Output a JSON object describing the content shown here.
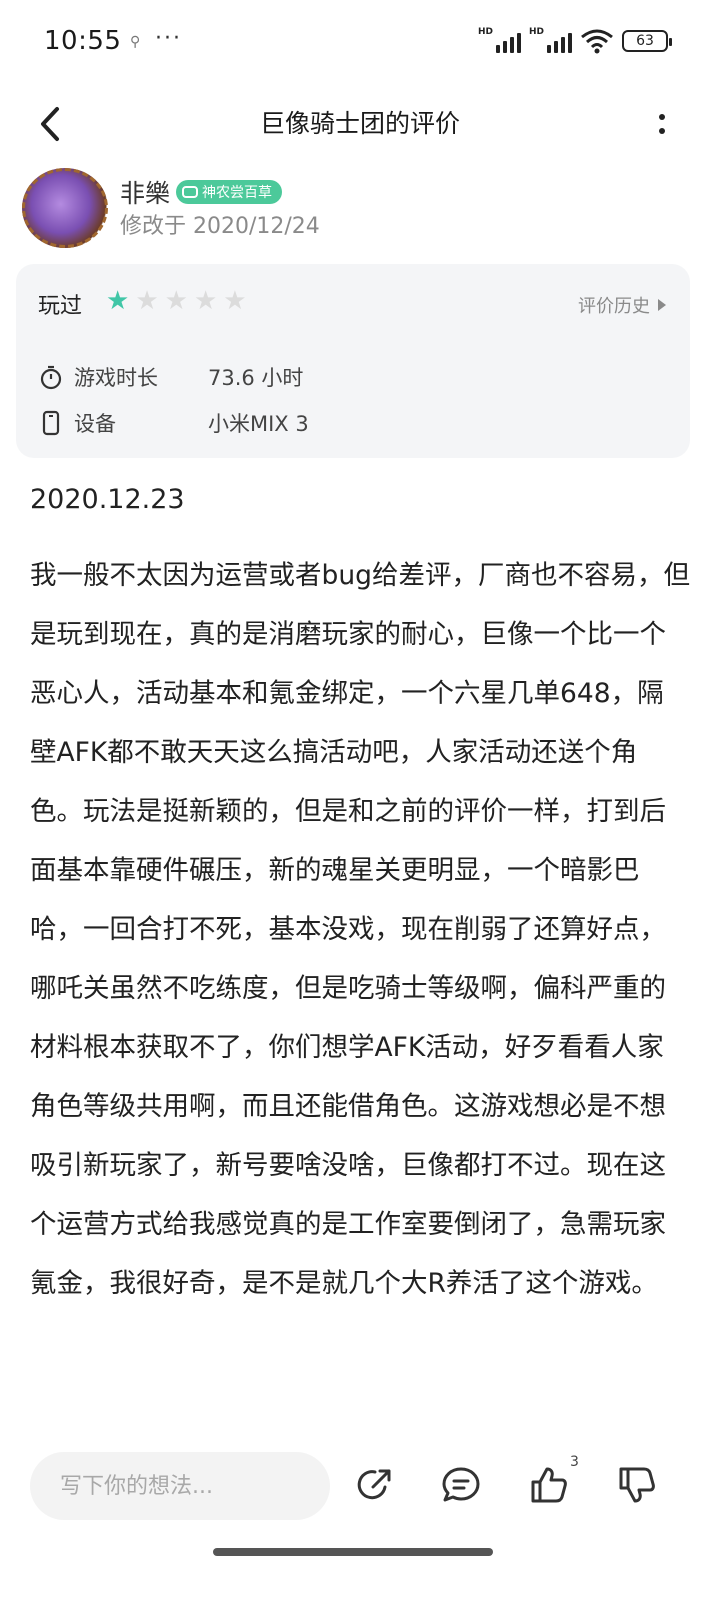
{
  "status_bar": {
    "time": "10:55",
    "more": "···",
    "hd1": "HD",
    "hd2": "HD",
    "battery": "63"
  },
  "nav": {
    "title": "巨像骑士团的评价"
  },
  "author": {
    "name": "非樂",
    "badge": "神农尝百草",
    "modified": "修改于 2020/12/24"
  },
  "card": {
    "played_label": "玩过",
    "rating": 1,
    "max_rating": 5,
    "history_label": "评价历史",
    "playtime_label": "游戏时长",
    "playtime_value": "73.6 小时",
    "device_label": "设备",
    "device_value": "小米MIX 3"
  },
  "review": {
    "date": "2020.12.23",
    "text": "我一般不太因为运营或者bug给差评，厂商也不容易，但是玩到现在，真的是消磨玩家的耐心，巨像一个比一个恶心人，活动基本和氪金绑定，一个六星几单648，隔壁AFK都不敢天天这么搞活动吧，人家活动还送个角色。玩法是挺新颖的，但是和之前的评价一样，打到后面基本靠硬件碾压，新的魂星关更明显，一个暗影巴哈，一回合打不死，基本没戏，现在削弱了还算好点，哪吒关虽然不吃练度，但是吃骑士等级啊，偏科严重的材料根本获取不了，你们想学AFK活动，好歹看看人家角色等级共用啊，而且还能借角色。这游戏想必是不想吸引新玩家了，新号要啥没啥，巨像都打不过。现在这个运营方式给我感觉真的是工作室要倒闭了，急需玩家氪金，我很好奇，是不是就几个大R养活了这个游戏。"
  },
  "bottom_bar": {
    "comment_placeholder": "写下你的想法...",
    "like_count": "3"
  },
  "colors": {
    "star_active": "#40c6a7",
    "star_inactive": "#dcdcdc",
    "badge": "#4cc99a",
    "card_bg": "#f4f5f7"
  },
  "icons": [
    "back-arrow-icon",
    "more-vertical-icon",
    "gamepad-icon",
    "star-icon",
    "chevron-right-icon",
    "stopwatch-icon",
    "phone-icon",
    "share-icon",
    "comment-icon",
    "thumbs-up-icon",
    "thumbs-down-icon"
  ]
}
